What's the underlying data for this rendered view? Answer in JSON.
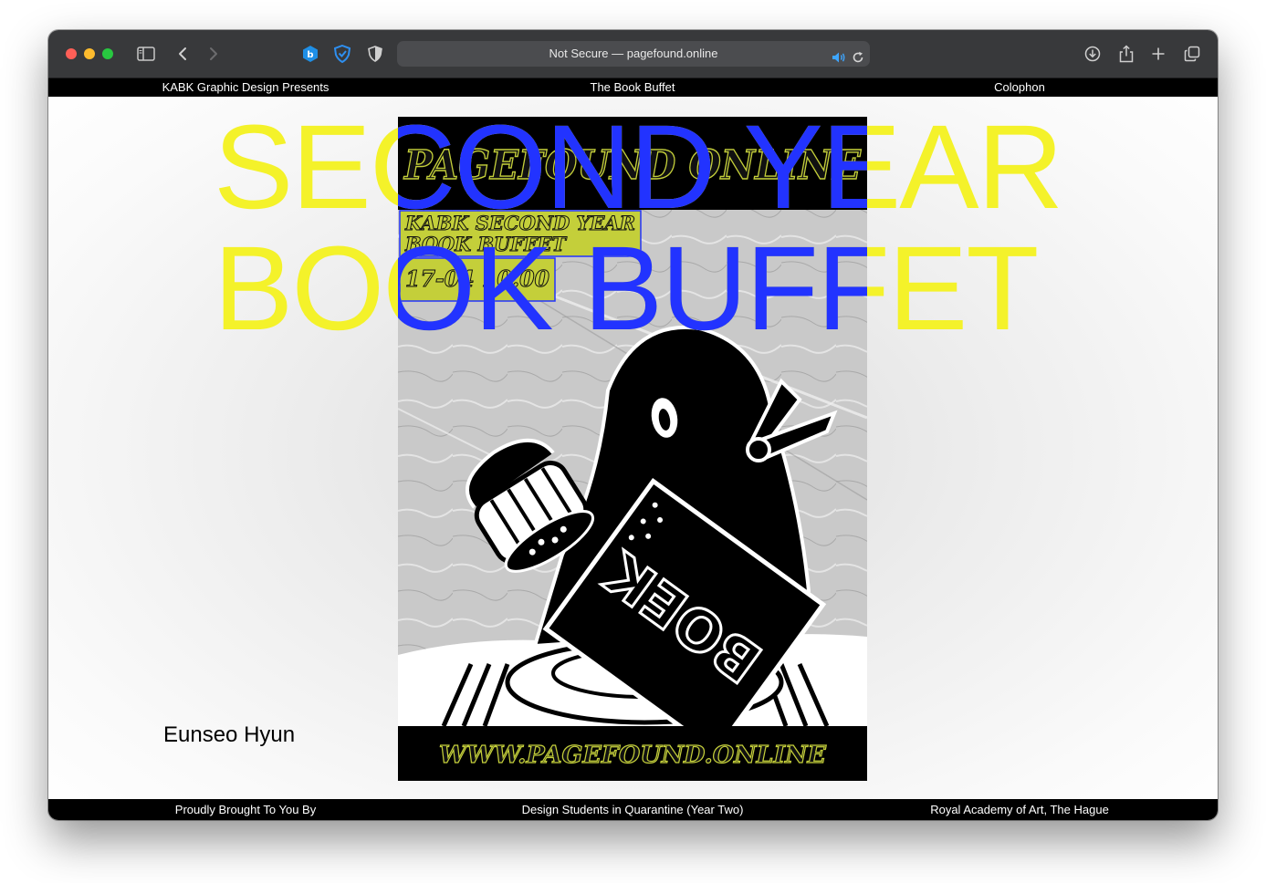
{
  "browser": {
    "address": "Not Secure — pagefound.online",
    "icons": [
      "sidebar-icon",
      "back-icon",
      "forward-icon",
      "extension-icon",
      "privacy-shield-icon",
      "half-shield-icon",
      "audio-icon",
      "reload-icon",
      "download-icon",
      "share-icon",
      "new-tab-icon",
      "tabs-overview-icon"
    ]
  },
  "nav": {
    "top": [
      "KABK Graphic Design Presents",
      "The Book Buffet",
      "Colophon"
    ],
    "bottom": [
      "Proudly Brought To You By",
      "Design Students in Quarantine (Year Two)",
      "Royal Academy of Art, The Hague"
    ]
  },
  "hero": {
    "line1": "SECOND YEAR",
    "line2": "BOOK BUFFET"
  },
  "poster": {
    "header": "PAGEFOUND ONLINE",
    "subtitle_line1": "KABK SECOND YEAR",
    "subtitle_line2": "BOOK BUFFET",
    "date": "17-04 10.00",
    "book_label": "BOEK",
    "footer": "WWW.PAGEFOUND.ONLINE"
  },
  "artist": "Eunseo Hyun",
  "colors": {
    "hero_yellow": "#f4f22a",
    "overlay_blue": "#2233ff",
    "poster_lime": "#c4cf3a",
    "chrome": "#38393b"
  }
}
